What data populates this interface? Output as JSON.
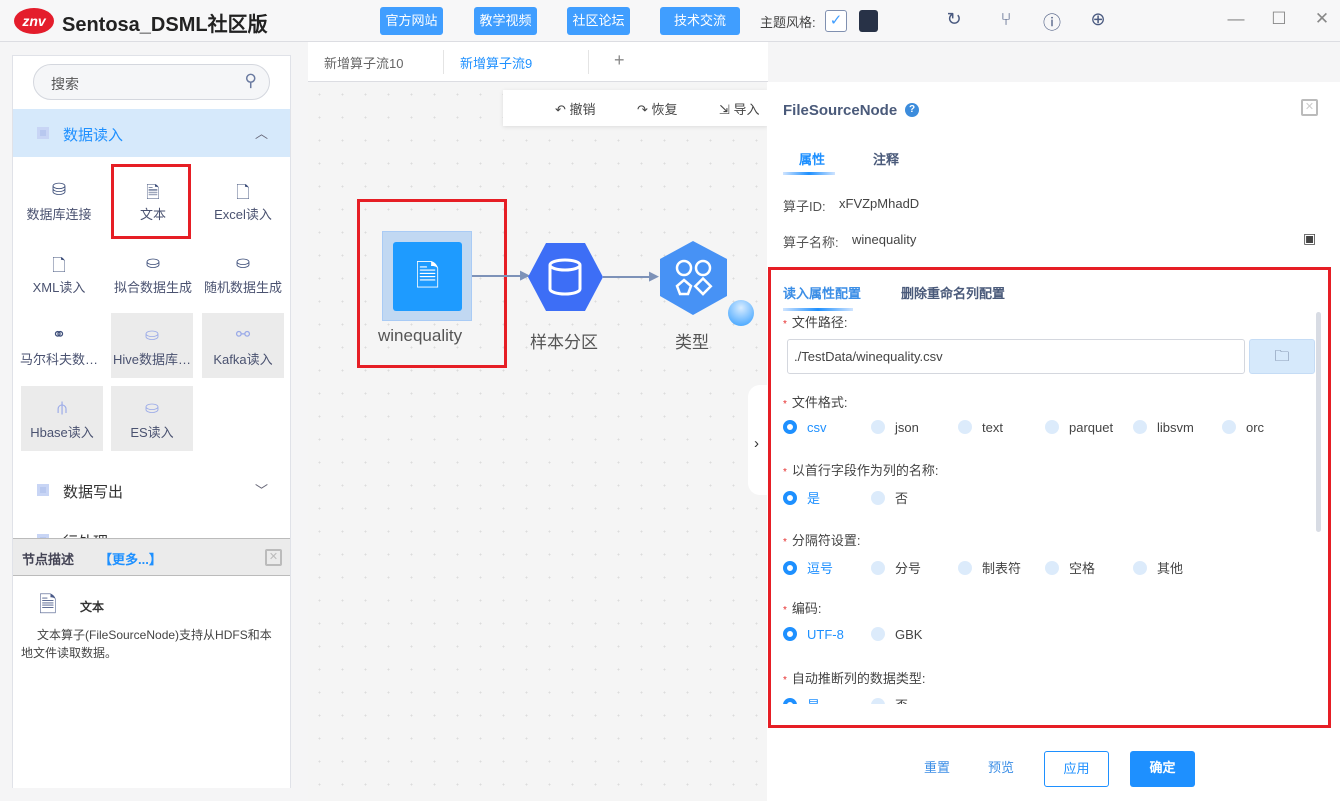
{
  "app": {
    "logo": "znv",
    "title": "Sentosa_DSML社区版"
  },
  "top_buttons": [
    "官方网站",
    "教学视频",
    "社区论坛",
    "技术交流"
  ],
  "theme": {
    "label": "主题风格:",
    "checked": true
  },
  "top_icons": [
    "refresh-icon",
    "branch-icon",
    "help-icon",
    "globe-icon"
  ],
  "window_controls": [
    "minimize-icon",
    "maximize-icon",
    "close-icon"
  ],
  "sidebar": {
    "search_placeholder": "搜索",
    "categories": [
      {
        "label": "数据读入",
        "expanded": true
      },
      {
        "label": "数据写出",
        "expanded": false
      },
      {
        "label": "行处理",
        "expanded": false
      }
    ],
    "items": [
      {
        "label": "数据库连接",
        "icon": "database-connect-icon",
        "enabled": true
      },
      {
        "label": "文本",
        "icon": "text-file-icon",
        "enabled": true,
        "highlighted": true
      },
      {
        "label": "Excel读入",
        "icon": "excel-file-icon",
        "enabled": true
      },
      {
        "label": "XML读入",
        "icon": "xml-file-icon",
        "enabled": true
      },
      {
        "label": "拟合数据生成",
        "icon": "fit-data-icon",
        "enabled": true
      },
      {
        "label": "随机数据生成",
        "icon": "random-data-icon",
        "enabled": true
      },
      {
        "label": "马尔科夫数…",
        "icon": "markov-icon",
        "enabled": true
      },
      {
        "label": "Hive数据库…",
        "icon": "hive-icon",
        "enabled": false
      },
      {
        "label": "Kafka读入",
        "icon": "kafka-icon",
        "enabled": false
      },
      {
        "label": "Hbase读入",
        "icon": "hbase-icon",
        "enabled": false
      },
      {
        "label": "ES读入",
        "icon": "es-icon",
        "enabled": false
      }
    ],
    "desc": {
      "title": "节点描述",
      "more": "【更多...】",
      "node_name": "文本",
      "text": "文本算子(FileSourceNode)支持从HDFS和本地文件读取数据。"
    }
  },
  "tabs": [
    {
      "label": "新增算子流10",
      "active": false
    },
    {
      "label": "新增算子流9",
      "active": true
    }
  ],
  "tab_add": "+",
  "toolbar": {
    "undo": "撤销",
    "redo": "恢复",
    "import": "导入"
  },
  "canvas": {
    "nodes": [
      {
        "label": "winequality",
        "icon": "text-file-icon"
      },
      {
        "label": "样本分区",
        "icon": "partition-icon"
      },
      {
        "label": "类型",
        "icon": "type-icon"
      }
    ]
  },
  "panel": {
    "title": "FileSourceNode",
    "tabs": [
      {
        "label": "属性",
        "active": true
      },
      {
        "label": "注释",
        "active": false
      }
    ],
    "id_label": "算子ID:",
    "id_value": "xFVZpMhadD",
    "name_label": "算子名称:",
    "name_value": "winequality",
    "subtabs": [
      {
        "label": "读入属性配置",
        "active": true
      },
      {
        "label": "删除重命名列配置",
        "active": false
      }
    ],
    "file_path_label": "文件路径:",
    "file_path_value": "./TestData/winequality.csv",
    "format_label": "文件格式:",
    "formats": [
      "csv",
      "json",
      "text",
      "parquet",
      "libsvm",
      "orc"
    ],
    "format_selected": "csv",
    "header_label": "以首行字段作为列的名称:",
    "header_options": [
      "是",
      "否"
    ],
    "header_selected": "是",
    "sep_label": "分隔符设置:",
    "sep_options": [
      "逗号",
      "分号",
      "制表符",
      "空格",
      "其他"
    ],
    "sep_selected": "逗号",
    "enc_label": "编码:",
    "enc_options": [
      "UTF-8",
      "GBK"
    ],
    "enc_selected": "UTF-8",
    "infer_label": "自动推断列的数据类型:",
    "infer_options": [
      "是",
      "否"
    ],
    "infer_selected": "是",
    "footer": {
      "reset": "重置",
      "preview": "预览",
      "apply": "应用",
      "ok": "确定"
    }
  },
  "colors": {
    "accent": "#1e90ff",
    "highlight": "#e61e25",
    "node_blue": "#1e9bff",
    "partition": "#3d6ef6"
  }
}
